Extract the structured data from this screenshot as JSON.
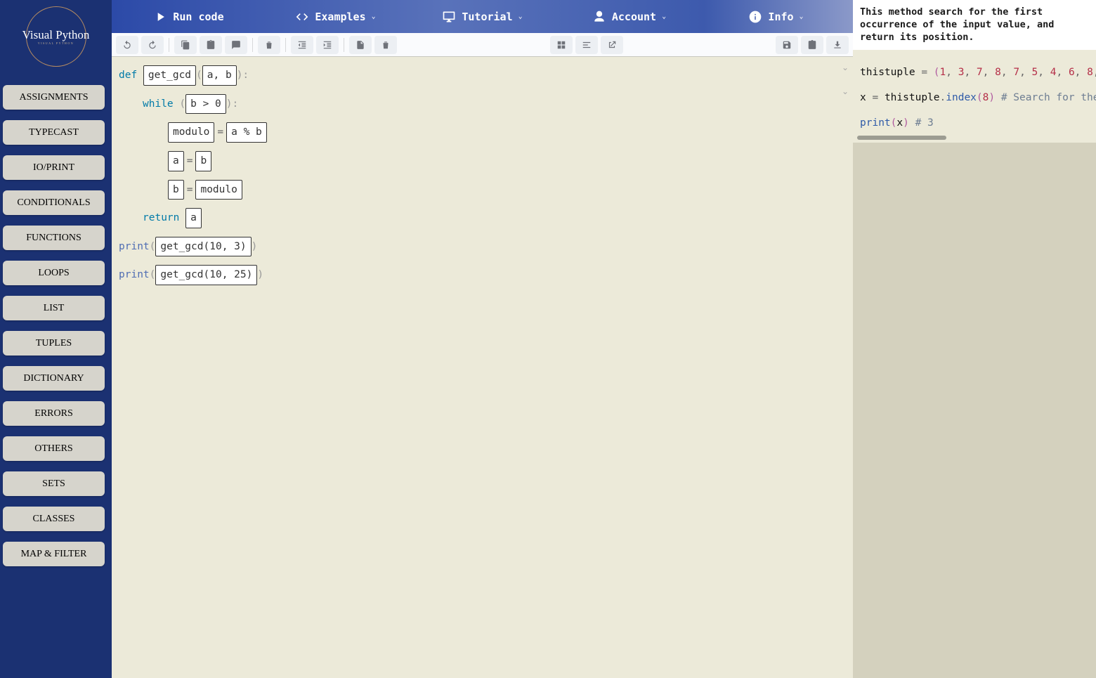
{
  "logo": {
    "main": "Visual Python",
    "sub": "VISUAL PYTHON"
  },
  "sidebar": {
    "categories": [
      "ASSIGNMENTS",
      "TYPECAST",
      "IO/PRINT",
      "CONDITIONALS",
      "FUNCTIONS",
      "LOOPS",
      "LIST",
      "TUPLES",
      "DICTIONARY",
      "ERRORS",
      "OTHERS",
      "SETS",
      "CLASSES",
      "MAP & FILTER"
    ]
  },
  "topnav": {
    "run": "Run code",
    "examples": "Examples",
    "tutorial": "Tutorial",
    "account": "Account",
    "info": "Info"
  },
  "editor": {
    "l1": {
      "def": "def ",
      "name": "get_gcd",
      "args": "a, b"
    },
    "l2": {
      "while": "while ",
      "cond": "b > 0"
    },
    "l3": {
      "lhs": "modulo",
      "rhs": "a % b"
    },
    "l4": {
      "lhs": "a",
      "rhs": "b"
    },
    "l5": {
      "lhs": "b",
      "rhs": "modulo"
    },
    "l6": {
      "ret": "return ",
      "val": "a"
    },
    "l7": {
      "fn": "print",
      "call": "get_gcd(10, 3)"
    },
    "l8": {
      "fn": "print",
      "call": "get_gcd(10, 25)"
    }
  },
  "right": {
    "desc": "This method search for the first occurrence of the input value, and return its position.",
    "line1": {
      "var": "thistuple",
      "nums": [
        "1",
        "3",
        "7",
        "8",
        "7",
        "5",
        "4",
        "6",
        "8"
      ]
    },
    "line2": {
      "x": "x",
      "obj": "thistuple",
      "method": "index",
      "arg": "8",
      "comment": "# Search for the"
    },
    "line3": {
      "fn": "print",
      "arg": "x",
      "comment": "# 3"
    }
  }
}
